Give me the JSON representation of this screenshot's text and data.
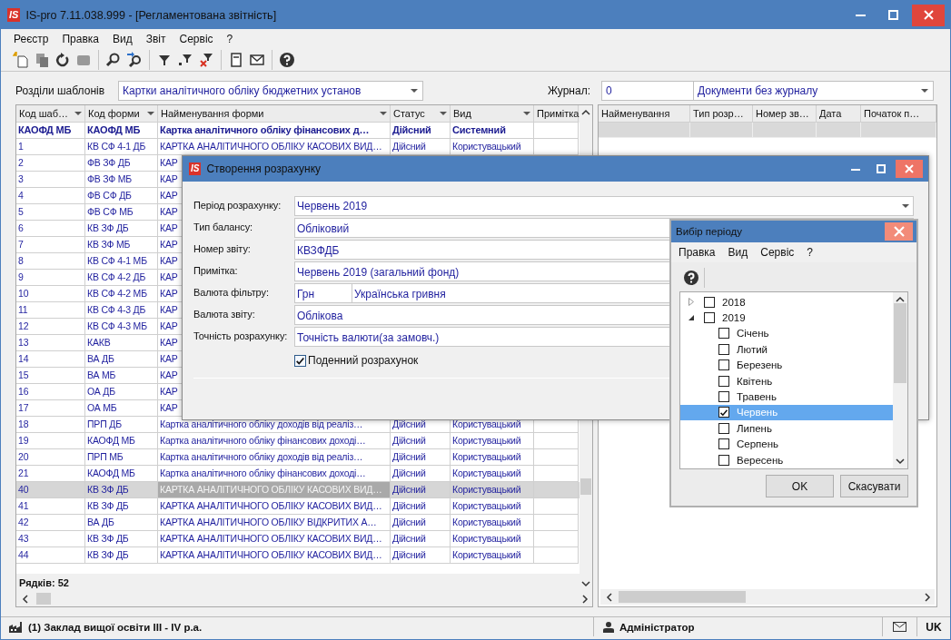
{
  "window": {
    "logo": "IS",
    "title": "IS-pro 7.11.038.999 - [Регламентована звітність]"
  },
  "menu": [
    "Реєстр",
    "Правка",
    "Вид",
    "Звіт",
    "Сервіс",
    "?"
  ],
  "filters": {
    "sections_label": "Розділи шаблонів",
    "sections_value": "Картки аналітичного обліку бюджетних установ",
    "journal_label": "Журнал:",
    "journal_code": "0",
    "journal_value": "Документи без журналу"
  },
  "templates_table": {
    "columns": [
      "Код шаб…",
      "Код форми",
      "Найменування форми",
      "Статус",
      "Вид",
      "Примітка"
    ],
    "rows": [
      {
        "kind": "filter",
        "selected": false,
        "cells": [
          "КАОФД МБ",
          "КАОФД МБ",
          "Картка аналітичного обліку фінансових д…",
          "Дійсний",
          "Системний"
        ]
      },
      {
        "kind": "data",
        "selected": false,
        "cells": [
          "1",
          "КВ СФ 4-1 ДБ",
          "КАРТКА АНАЛІТИЧНОГО ОБЛІКУ КАСОВИХ ВИД…",
          "Дійсний",
          "Користувацький"
        ]
      },
      {
        "kind": "data",
        "selected": false,
        "cells": [
          "2",
          "ФВ ЗФ ДБ",
          "КАР"
        ]
      },
      {
        "kind": "data",
        "selected": false,
        "cells": [
          "3",
          "ФВ ЗФ МБ",
          "КАР"
        ]
      },
      {
        "kind": "data",
        "selected": false,
        "cells": [
          "4",
          "ФВ СФ ДБ",
          "КАР"
        ]
      },
      {
        "kind": "data",
        "selected": false,
        "cells": [
          "5",
          "ФВ СФ МБ",
          "КАР"
        ]
      },
      {
        "kind": "data",
        "selected": false,
        "cells": [
          "6",
          "КВ ЗФ ДБ",
          "КАР"
        ]
      },
      {
        "kind": "data",
        "selected": false,
        "cells": [
          "7",
          "КВ ЗФ МБ",
          "КАР"
        ]
      },
      {
        "kind": "data",
        "selected": false,
        "cells": [
          "8",
          "КВ СФ 4-1 МБ",
          "КАР"
        ]
      },
      {
        "kind": "data",
        "selected": false,
        "cells": [
          "9",
          "КВ СФ 4-2 ДБ",
          "КАР"
        ]
      },
      {
        "kind": "data",
        "selected": false,
        "cells": [
          "10",
          "КВ СФ 4-2 МБ",
          "КАР"
        ]
      },
      {
        "kind": "data",
        "selected": false,
        "cells": [
          "11",
          "КВ СФ 4-3 ДБ",
          "КАР"
        ]
      },
      {
        "kind": "data",
        "selected": false,
        "cells": [
          "12",
          "КВ СФ 4-3 МБ",
          "КАР"
        ]
      },
      {
        "kind": "data",
        "selected": false,
        "cells": [
          "13",
          "КАКВ",
          "КАР"
        ]
      },
      {
        "kind": "data",
        "selected": false,
        "cells": [
          "14",
          "ВА ДБ",
          "КАР"
        ]
      },
      {
        "kind": "data",
        "selected": false,
        "cells": [
          "15",
          "ВА МБ",
          "КАР"
        ]
      },
      {
        "kind": "data",
        "selected": false,
        "cells": [
          "16",
          "ОА ДБ",
          "КАР"
        ]
      },
      {
        "kind": "data",
        "selected": false,
        "cells": [
          "17",
          "ОА МБ",
          "КАР"
        ]
      },
      {
        "kind": "data",
        "selected": false,
        "cells": [
          "18",
          "ПРП ДБ",
          "Картка аналітичного обліку доходів від реаліз…",
          "Дійсний",
          "Користувацький"
        ]
      },
      {
        "kind": "data",
        "selected": false,
        "cells": [
          "19",
          "КАОФД МБ",
          "Картка аналітичного обліку фінансових доході…",
          "Дійсний",
          "Користувацький"
        ]
      },
      {
        "kind": "data",
        "selected": false,
        "cells": [
          "20",
          "ПРП МБ",
          "Картка аналітичного обліку доходів від реаліз…",
          "Дійсний",
          "Користувацький"
        ]
      },
      {
        "kind": "data",
        "selected": false,
        "cells": [
          "21",
          "КАОФД МБ",
          "Картка аналітичного обліку фінансових доході…",
          "Дійсний",
          "Користувацький"
        ]
      },
      {
        "kind": "data",
        "selected": true,
        "cells": [
          "40",
          "КВ ЗФ ДБ",
          "КАРТКА АНАЛІТИЧНОГО ОБЛІКУ КАСОВИХ ВИД…",
          "Дійсний",
          "Користувацький"
        ]
      },
      {
        "kind": "data",
        "selected": false,
        "cells": [
          "41",
          "КВ ЗФ ДБ",
          "КАРТКА АНАЛІТИЧНОГО ОБЛІКУ КАСОВИХ ВИД…",
          "Дійсний",
          "Користувацький"
        ]
      },
      {
        "kind": "data",
        "selected": false,
        "cells": [
          "42",
          "ВА ДБ",
          "КАРТКА АНАЛІТИЧНОГО ОБЛІКУ ВІДКРИТИХ А…",
          "Дійсний",
          "Користувацький"
        ]
      },
      {
        "kind": "data",
        "selected": false,
        "cells": [
          "43",
          "КВ ЗФ ДБ",
          "КАРТКА АНАЛІТИЧНОГО ОБЛІКУ КАСОВИХ ВИД…",
          "Дійсний",
          "Користувацький"
        ]
      },
      {
        "kind": "data",
        "selected": false,
        "cells": [
          "44",
          "КВ ЗФ ДБ",
          "КАРТКА АНАЛІТИЧНОГО ОБЛІКУ КАСОВИХ ВИД…",
          "Дійсний",
          "Користувацький"
        ]
      }
    ],
    "row_count": "Рядків: 52"
  },
  "calculations_table": {
    "columns": [
      "Найменування",
      "Тип розр…",
      "Номер зв…",
      "Дата",
      "Початок п…"
    ]
  },
  "dialog": {
    "logo": "IS",
    "title": "Створення розрахунку",
    "fields": [
      {
        "kind": "combo",
        "label": "Період розрахунку:",
        "value": "Червень 2019"
      },
      {
        "kind": "text",
        "label": "Тип балансу:",
        "value": "Обліковий"
      },
      {
        "kind": "text",
        "label": "Номер звіту:",
        "value": "КВЗФДБ"
      },
      {
        "kind": "text",
        "label": "Примітка:",
        "value": "Червень 2019 (загальний фонд)"
      },
      {
        "kind": "pair",
        "label": "Валюта фільтру:",
        "code": "Грн",
        "value": "Українська гривня"
      },
      {
        "kind": "text",
        "label": "Валюта звіту:",
        "value": "Облікова"
      },
      {
        "kind": "text",
        "label": "Точність розрахунку:",
        "value": "Точність валюти(за замовч.)"
      }
    ],
    "checkbox": {
      "label": "Поденний розрахунок",
      "checked": true
    }
  },
  "period_dialog": {
    "title": "Вибір періоду",
    "menu": [
      "Правка",
      "Вид",
      "Сервіс",
      "?"
    ],
    "tree": [
      {
        "label": "2018",
        "expanded": false,
        "checked": false,
        "selected": false
      },
      {
        "label": "2019",
        "expanded": true,
        "checked": false,
        "selected": false,
        "children": [
          {
            "label": "Січень",
            "checked": false,
            "selected": false
          },
          {
            "label": "Лютий",
            "checked": false,
            "selected": false
          },
          {
            "label": "Березень",
            "checked": false,
            "selected": false
          },
          {
            "label": "Квітень",
            "checked": false,
            "selected": false
          },
          {
            "label": "Травень",
            "checked": false,
            "selected": false
          },
          {
            "label": "Червень",
            "checked": true,
            "selected": true
          },
          {
            "label": "Липень",
            "checked": false,
            "selected": false
          },
          {
            "label": "Серпень",
            "checked": false,
            "selected": false
          },
          {
            "label": "Вересень",
            "checked": false,
            "selected": false
          }
        ]
      }
    ],
    "buttons": [
      "OK",
      "Скасувати"
    ]
  },
  "status_bar": {
    "organization": "(1) Заклад вищої освіти III - IV р.а.",
    "user": "Адміністратор",
    "language": "UK"
  }
}
